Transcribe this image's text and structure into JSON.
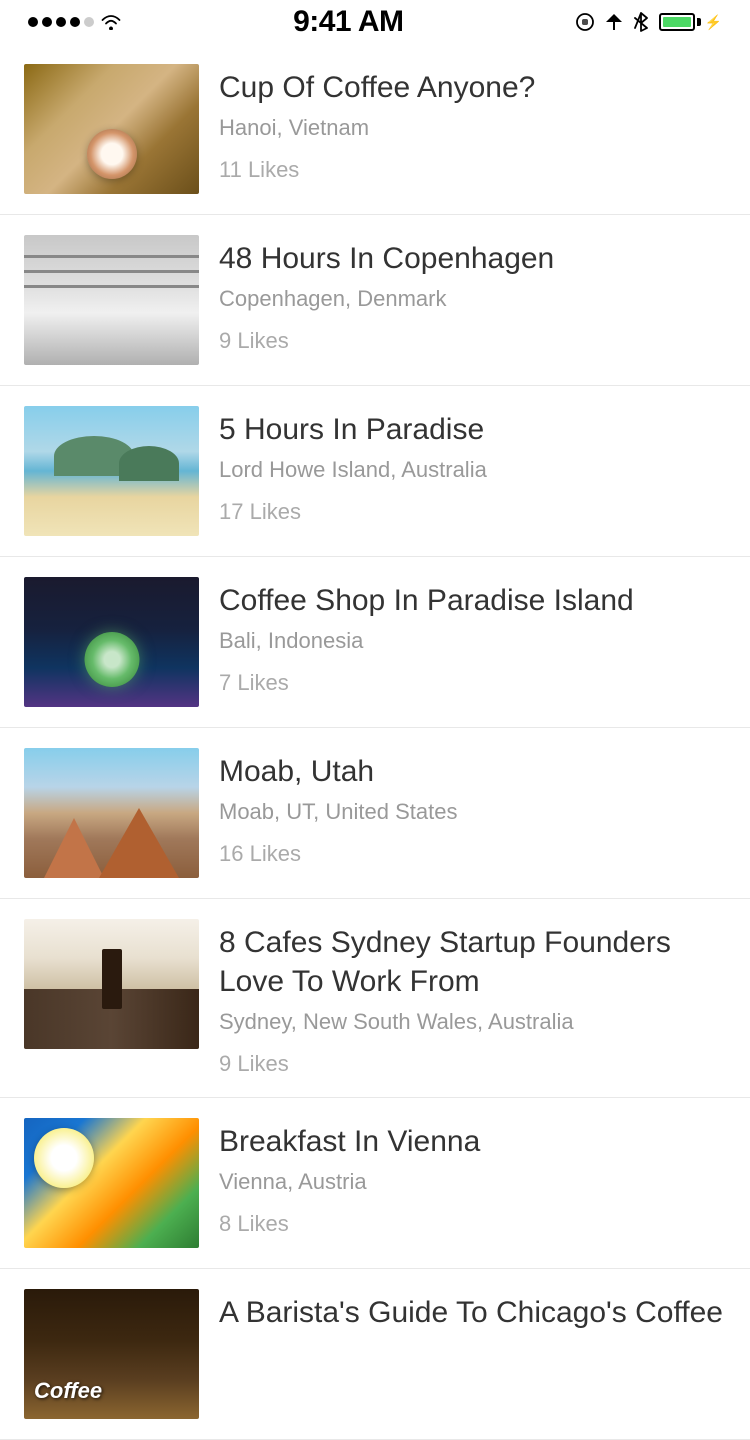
{
  "statusBar": {
    "time": "9:41 AM",
    "signalDots": 5,
    "carrier": "signal"
  },
  "feed": {
    "items": [
      {
        "id": "coffee-vietnam",
        "title": "Cup Of Coffee Anyone?",
        "location": "Hanoi, Vietnam",
        "likes": "11 Likes",
        "thumbnail": "thumb-coffee"
      },
      {
        "id": "copenhagen",
        "title": "48 Hours In Copenhagen",
        "location": "Copenhagen, Denmark",
        "likes": "9 Likes",
        "thumbnail": "thumb-copenhagen"
      },
      {
        "id": "paradise",
        "title": "5 Hours In Paradise",
        "location": "Lord Howe Island, Australia",
        "likes": "17 Likes",
        "thumbnail": "thumb-paradise"
      },
      {
        "id": "bali",
        "title": "Coffee Shop In Paradise Island",
        "location": "Bali, Indonesia",
        "likes": "7 Likes",
        "thumbnail": "thumb-bali"
      },
      {
        "id": "moab",
        "title": "Moab, Utah",
        "location": "Moab, UT, United States",
        "likes": "16 Likes",
        "thumbnail": "thumb-moab"
      },
      {
        "id": "sydney",
        "title": "8 Cafes Sydney Startup Founders Love To Work From",
        "location": "Sydney, New South Wales, Australia",
        "likes": "9 Likes",
        "thumbnail": "thumb-sydney"
      },
      {
        "id": "vienna",
        "title": "Breakfast In Vienna",
        "location": "Vienna, Austria",
        "likes": "8 Likes",
        "thumbnail": "thumb-vienna"
      },
      {
        "id": "chicago",
        "title": "A Barista's Guide To Chicago's Coffee",
        "location": "",
        "likes": "",
        "thumbnail": "thumb-chicago"
      }
    ]
  }
}
